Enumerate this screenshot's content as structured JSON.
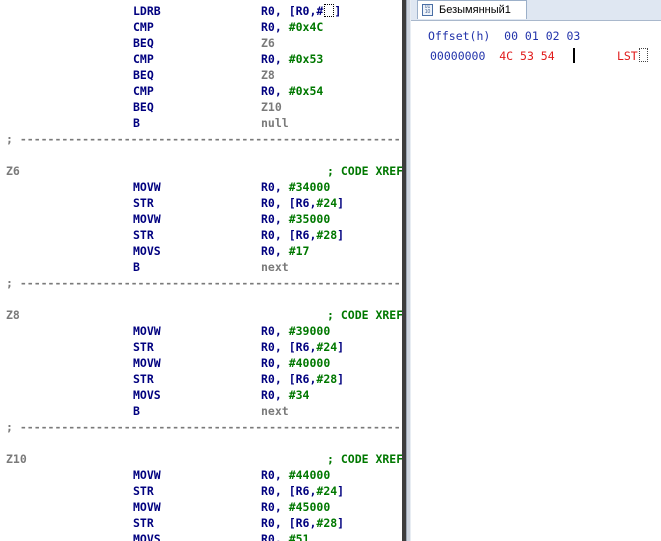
{
  "disassembly": {
    "rows": [
      {
        "type": "ins",
        "label": "",
        "mnemonic": "LDRB",
        "operands": [
          {
            "t": "reg",
            "v": "R0, [R0,#"
          }
        ],
        "caret": true
      },
      {
        "type": "ins",
        "label": "",
        "mnemonic": "CMP",
        "operands": [
          {
            "t": "reg",
            "v": "R0, "
          },
          {
            "t": "imm",
            "v": "#0x4C"
          }
        ]
      },
      {
        "type": "ins",
        "label": "",
        "mnemonic": "BEQ",
        "operands": [
          {
            "t": "lab",
            "v": "Z6"
          }
        ]
      },
      {
        "type": "ins",
        "label": "",
        "mnemonic": "CMP",
        "operands": [
          {
            "t": "reg",
            "v": "R0, "
          },
          {
            "t": "imm",
            "v": "#0x53"
          }
        ]
      },
      {
        "type": "ins",
        "label": "",
        "mnemonic": "BEQ",
        "operands": [
          {
            "t": "lab",
            "v": "Z8"
          }
        ]
      },
      {
        "type": "ins",
        "label": "",
        "mnemonic": "CMP",
        "operands": [
          {
            "t": "reg",
            "v": "R0, "
          },
          {
            "t": "imm",
            "v": "#0x54"
          }
        ]
      },
      {
        "type": "ins",
        "label": "",
        "mnemonic": "BEQ",
        "operands": [
          {
            "t": "lab",
            "v": "Z10"
          }
        ]
      },
      {
        "type": "ins",
        "label": "",
        "mnemonic": "B",
        "operands": [
          {
            "t": "lab",
            "v": "null"
          }
        ]
      },
      {
        "type": "sep",
        "text": "; -----------------------------------------------------------------"
      },
      {
        "type": "blank"
      },
      {
        "type": "label",
        "label": "Z6",
        "comment": "; CODE XREF"
      },
      {
        "type": "ins",
        "label": "",
        "mnemonic": "MOVW",
        "operands": [
          {
            "t": "reg",
            "v": "R0, "
          },
          {
            "t": "imm",
            "v": "#34000"
          }
        ]
      },
      {
        "type": "ins",
        "label": "",
        "mnemonic": "STR",
        "operands": [
          {
            "t": "reg",
            "v": "R0, [R6,"
          },
          {
            "t": "imm",
            "v": "#24"
          },
          {
            "t": "reg",
            "v": "]"
          }
        ]
      },
      {
        "type": "ins",
        "label": "",
        "mnemonic": "MOVW",
        "operands": [
          {
            "t": "reg",
            "v": "R0, "
          },
          {
            "t": "imm",
            "v": "#35000"
          }
        ]
      },
      {
        "type": "ins",
        "label": "",
        "mnemonic": "STR",
        "operands": [
          {
            "t": "reg",
            "v": "R0, [R6,"
          },
          {
            "t": "imm",
            "v": "#28"
          },
          {
            "t": "reg",
            "v": "]"
          }
        ]
      },
      {
        "type": "ins",
        "label": "",
        "mnemonic": "MOVS",
        "operands": [
          {
            "t": "reg",
            "v": "R0, "
          },
          {
            "t": "imm",
            "v": "#17"
          }
        ]
      },
      {
        "type": "ins",
        "label": "",
        "mnemonic": "B",
        "operands": [
          {
            "t": "lab",
            "v": "next"
          }
        ]
      },
      {
        "type": "sep",
        "text": "; -----------------------------------------------------------------"
      },
      {
        "type": "blank"
      },
      {
        "type": "label",
        "label": "Z8",
        "comment": "; CODE XREF"
      },
      {
        "type": "ins",
        "label": "",
        "mnemonic": "MOVW",
        "operands": [
          {
            "t": "reg",
            "v": "R0, "
          },
          {
            "t": "imm",
            "v": "#39000"
          }
        ]
      },
      {
        "type": "ins",
        "label": "",
        "mnemonic": "STR",
        "operands": [
          {
            "t": "reg",
            "v": "R0, [R6,"
          },
          {
            "t": "imm",
            "v": "#24"
          },
          {
            "t": "reg",
            "v": "]"
          }
        ]
      },
      {
        "type": "ins",
        "label": "",
        "mnemonic": "MOVW",
        "operands": [
          {
            "t": "reg",
            "v": "R0, "
          },
          {
            "t": "imm",
            "v": "#40000"
          }
        ]
      },
      {
        "type": "ins",
        "label": "",
        "mnemonic": "STR",
        "operands": [
          {
            "t": "reg",
            "v": "R0, [R6,"
          },
          {
            "t": "imm",
            "v": "#28"
          },
          {
            "t": "reg",
            "v": "]"
          }
        ]
      },
      {
        "type": "ins",
        "label": "",
        "mnemonic": "MOVS",
        "operands": [
          {
            "t": "reg",
            "v": "R0, "
          },
          {
            "t": "imm",
            "v": "#34"
          }
        ]
      },
      {
        "type": "ins",
        "label": "",
        "mnemonic": "B",
        "operands": [
          {
            "t": "lab",
            "v": "next"
          }
        ]
      },
      {
        "type": "sep",
        "text": "; -----------------------------------------------------------------"
      },
      {
        "type": "blank"
      },
      {
        "type": "label",
        "label": "Z10",
        "comment": "; CODE XREF"
      },
      {
        "type": "ins",
        "label": "",
        "mnemonic": "MOVW",
        "operands": [
          {
            "t": "reg",
            "v": "R0, "
          },
          {
            "t": "imm",
            "v": "#44000"
          }
        ]
      },
      {
        "type": "ins",
        "label": "",
        "mnemonic": "STR",
        "operands": [
          {
            "t": "reg",
            "v": "R0, [R6,"
          },
          {
            "t": "imm",
            "v": "#24"
          },
          {
            "t": "reg",
            "v": "]"
          }
        ]
      },
      {
        "type": "ins",
        "label": "",
        "mnemonic": "MOVW",
        "operands": [
          {
            "t": "reg",
            "v": "R0, "
          },
          {
            "t": "imm",
            "v": "#45000"
          }
        ]
      },
      {
        "type": "ins",
        "label": "",
        "mnemonic": "STR",
        "operands": [
          {
            "t": "reg",
            "v": "R0, [R6,"
          },
          {
            "t": "imm",
            "v": "#28"
          },
          {
            "t": "reg",
            "v": "]"
          }
        ]
      },
      {
        "type": "ins",
        "label": "",
        "mnemonic": "MOVS",
        "operands": [
          {
            "t": "reg",
            "v": "R0, "
          },
          {
            "t": "imm",
            "v": "#51"
          }
        ]
      }
    ]
  },
  "hex_view": {
    "tab_label": "Безымянный1",
    "tab_icon": "hex-file-icon",
    "header": "Offset(h)  00 01 02 03",
    "offset": "00000000",
    "bytes": "4C 53 54",
    "text": "LST"
  },
  "colors": {
    "mnemonic": "#00007f",
    "immediate": "#007800",
    "label": "#7a7a7a",
    "hex_header": "#2233aa",
    "hex_data": "#e01919"
  }
}
